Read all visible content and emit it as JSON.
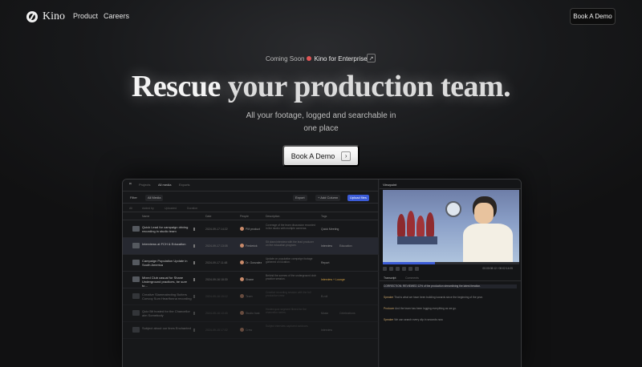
{
  "nav": {
    "brand": "Kino",
    "links": [
      "Product",
      "Careers"
    ],
    "cta": "Book A Demo"
  },
  "hero": {
    "announce_prefix": "Coming Soon",
    "announce_strong": "Kino for Enterprise",
    "announce_arrow": "↗",
    "headline_a": "Rescue",
    "headline_b": "your production team.",
    "sub": "All your footage, logged and searchable in one place",
    "cta": "Book A Demo",
    "cta_chevron": "›"
  },
  "app": {
    "tabs": [
      "Projects",
      "All media",
      "Exports"
    ],
    "toolbar": {
      "filter": "Filter",
      "view": "All Media",
      "export": "Export",
      "add_columns": "+ Add Column",
      "upload": "Upload files"
    },
    "filters": [
      "All",
      "Added by",
      "Uploaded",
      "Duration"
    ],
    "columns": [
      "Name",
      "Date",
      "People",
      "Description",
      "Tags"
    ],
    "rows": [
      {
        "name": "Quick Lead for campaign driving recording in studio team",
        "date": "2024-09-17 14:22",
        "who": "PM product",
        "desc": "Coverage of the team discussion recorded in the studio with multiple cameras.",
        "tag": "Quick Meeting",
        "tag2": "",
        "amber": false,
        "selected": false,
        "faded": false
      },
      {
        "name": "Interviews at FCH & Education",
        "date": "2024-09-17 13:05",
        "who": "Frederick",
        "desc": "Sit down interview with the lead producer on the education program.",
        "tag": "Interview",
        "tag2": "Education",
        "amber": false,
        "selected": true,
        "faded": false
      },
      {
        "name": "Campaign Population Update in South America",
        "date": "2024-09-17 11:48",
        "who": "Dr. Gonzalez",
        "desc": "Update on population campaign footage gathered on location.",
        "tag": "Report",
        "tag2": "",
        "amber": false,
        "selected": false,
        "faded": false
      },
      {
        "name": "Mixed Club casual for Shane Underground practices, be sure to…",
        "date": "2024-09-16 18:30",
        "who": "Shane",
        "desc": "Behind the scenes of the underground club practice session.",
        "tag": "Interview + Lounge",
        "tag2": "",
        "amber": true,
        "selected": false,
        "faded": false
      },
      {
        "name": "Creative Slammalecting Butters Convoy Sum Heartfonna recording",
        "date": "2024-09-16 15:12",
        "who": "Team",
        "desc": "Creative recording session with the full production crew.",
        "tag": "B-roll",
        "tag2": "",
        "amber": false,
        "selected": false,
        "faded": true
      },
      {
        "name": "Quiz Bit hosted for the Chancellor aim Somebody",
        "date": "2024-09-16 10:40",
        "who": "Studio host",
        "desc": "Hosted quiz segment filmed for the chancellor series.",
        "tag": "Music",
        "tag2": "Celebrations",
        "amber": false,
        "selected": false,
        "faded": true
      },
      {
        "name": "Subject about our lines Enchanted",
        "date": "2024-09-15 17:02",
        "who": "Crew",
        "desc": "Subject interview captured outdoors.",
        "tag": "Interview",
        "tag2": "",
        "amber": false,
        "selected": false,
        "faded": true
      }
    ],
    "viewer": {
      "title": "Viewpoint",
      "timecode": "00:00:08:12 / 00:02:14:05",
      "tabs": [
        "Transcript",
        "Comments"
      ],
      "transcript": [
        {
          "speaker": "",
          "text": "CORRECTION: REVIEWED 12% of the production streamlining the latest iteration."
        },
        {
          "speaker": "Speaker",
          "text": "That is what we have been building towards since the beginning of the year."
        },
        {
          "speaker": "Producer",
          "text": "And the team has been logging everything as we go."
        },
        {
          "speaker": "Speaker",
          "text": "We can search every clip in seconds now."
        }
      ]
    }
  },
  "colors": {
    "accent": "#3b5bd6",
    "background": "#18191b",
    "amber_tag": "#d7a344"
  }
}
